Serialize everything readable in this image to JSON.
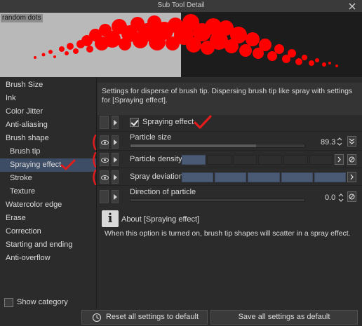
{
  "window": {
    "title": "Sub Tool Detail"
  },
  "preview": {
    "label": "random dots"
  },
  "sidebar": {
    "items": [
      {
        "label": "Brush Size"
      },
      {
        "label": "Ink"
      },
      {
        "label": "Color Jitter"
      },
      {
        "label": "Anti-aliasing"
      },
      {
        "label": "Brush shape"
      },
      {
        "label": "Brush tip"
      },
      {
        "label": "Spraying effect"
      },
      {
        "label": "Stroke"
      },
      {
        "label": "Texture"
      },
      {
        "label": "Watercolor edge"
      },
      {
        "label": "Erase"
      },
      {
        "label": "Correction"
      },
      {
        "label": "Starting and ending"
      },
      {
        "label": "Anti-overflow"
      }
    ],
    "show_category_label": "Show category"
  },
  "main": {
    "description": "Settings for disperse of brush tip. Dispersing brush tip like spray with settings for [Spraying effect].",
    "settings": {
      "spraying_effect": {
        "label": "Spraying effect",
        "checked": true
      },
      "particle_size": {
        "label": "Particle size",
        "value": "89.3"
      },
      "particle_density": {
        "label": "Particle density",
        "level": 0.12
      },
      "spray_deviation": {
        "label": "Spray deviation",
        "level": 1.0
      },
      "direction_of_particle": {
        "label": "Direction of particle",
        "value": "0.0"
      }
    },
    "about": {
      "title": "About [Spraying effect]",
      "text": "When this option is turned on, brush tip shapes will scatter in a spray effect."
    }
  },
  "footer": {
    "reset_label": "Reset all settings to default",
    "save_label": "Save all settings as default"
  },
  "colors": {
    "accent": "#3d4d66",
    "slider_fill": "#4a5a74",
    "annotation_red": "#e31b1b",
    "preview_left_bg": "#b9b9b9",
    "preview_right_bg": "#1c1c1c"
  }
}
